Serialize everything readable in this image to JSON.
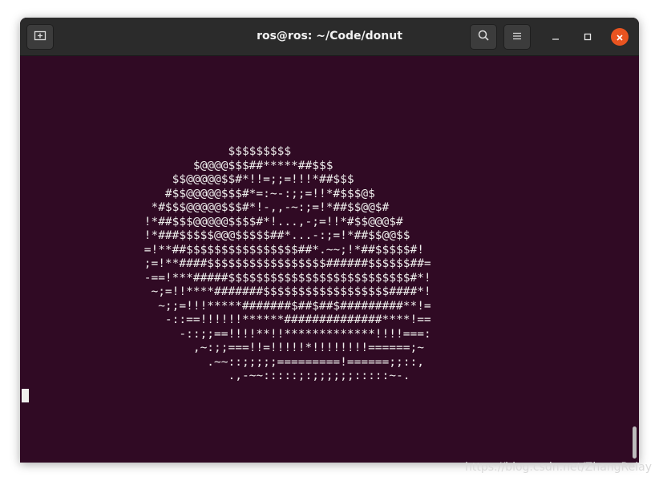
{
  "window": {
    "title": "ros@ros: ~/Code/donut"
  },
  "titlebar": {
    "new_tab_icon": "new-tab-icon",
    "search_icon": "search-icon",
    "menu_icon": "hamburger-menu-icon",
    "minimize_icon": "minimize-icon",
    "maximize_icon": "maximize-icon",
    "close_icon": "close-icon"
  },
  "colors": {
    "terminal_bg": "#300a24",
    "titlebar_bg": "#2b2b2b",
    "close_accent": "#e95420",
    "text": "#eeeeec"
  },
  "terminal": {
    "lines": [
      "             $$$$$$$$$",
      "        $@@@@$$$##*****##$$$",
      "     $$@@@@@$$#*!!=;;=!!!*##$$$",
      "    #$$@@@@@$$$#*=:~-:;;=!!*#$$$@$",
      "  *#$$$@@@@@$$$#*!-,,-~:;=!*##$$@@$#",
      " !*##$$$@@@@@$$$$#*!...,-;=!!*#$$@@@$#",
      " !*###$$$$$@@@$$$$$##*...-:;=!*##$$@@$$",
      " =!**##$$$$$$$$$$$$$$$$##*.~~;!*##$$$$$#!",
      " ;=!**####$$$$$$$$$$$$$$$$$######$$$$$$##=",
      " -==!***#####$$$$$$$$$$$$$$$$$$$$$$$$$$#*!",
      "  ~;=!!****#######$$$$$$$$$$$$$$$$$$####*!",
      "   ~;;=!!!*****#######$##$##$#########**!=",
      "    -::==!!!!!!******##############****!==",
      "      -::;;==!!!!**!!*************!!!!===:",
      "        ,~:;;===!!=!!!!!*!!!!!!!!======;~",
      "          .~~::;;;;;=========!======;;::,",
      "             .,-~~:::::;:;;;;;;:::::~-."
    ]
  },
  "watermark": {
    "text": "https://blog.csdn.net/ZhangRelay"
  }
}
